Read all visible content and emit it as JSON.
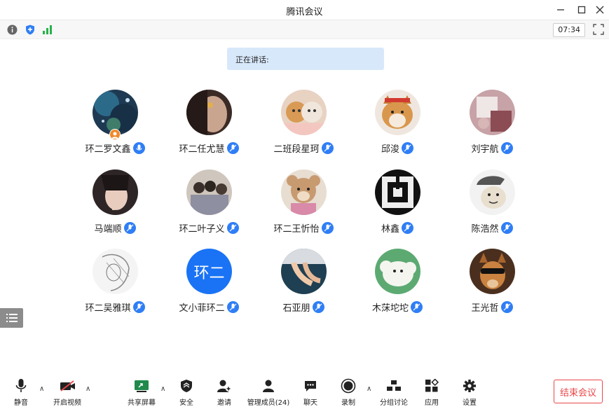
{
  "window": {
    "title": "腾讯会议"
  },
  "infobar": {
    "timer": "07:34"
  },
  "speaking": {
    "label": "正在讲话:"
  },
  "participants": [
    {
      "name": "环二罗文鑫",
      "avatar": "night-sky",
      "host": true
    },
    {
      "name": "环二任尤慧",
      "avatar": "dark-portrait"
    },
    {
      "name": "二班段星珂",
      "avatar": "cats"
    },
    {
      "name": "邱浚",
      "avatar": "shiba-dog"
    },
    {
      "name": "刘宇航",
      "avatar": "pink-photo"
    },
    {
      "name": "马端顺",
      "avatar": "anime-boy"
    },
    {
      "name": "环二叶子义",
      "avatar": "group-photo"
    },
    {
      "name": "环二王忻怡",
      "avatar": "teddy-bear"
    },
    {
      "name": "林鑫",
      "avatar": "maze-pattern"
    },
    {
      "name": "陈浩然",
      "avatar": "meme-face"
    },
    {
      "name": "环二吴雅琪",
      "avatar": "sketch-character"
    },
    {
      "name": "文小菲环二",
      "avatar": "text-avatar",
      "avatar_text": "环二"
    },
    {
      "name": "石亚朋",
      "avatar": "hands-photo"
    },
    {
      "name": "木莯坨坨",
      "avatar": "sheep-cartoon"
    },
    {
      "name": "王光哲",
      "avatar": "dog-sunglasses"
    }
  ],
  "toolbar": {
    "mute": "静音",
    "video": "开启视频",
    "share": "共享屏幕",
    "security": "安全",
    "invite": "邀请",
    "members": "管理成员(24)",
    "chat": "聊天",
    "record": "录制",
    "breakout": "分组讨论",
    "apps": "应用",
    "settings": "设置",
    "end": "结束会议"
  },
  "colors": {
    "accent": "#2f7ef5",
    "end": "#e9484a",
    "speaking_bg": "#d8e8fb"
  }
}
